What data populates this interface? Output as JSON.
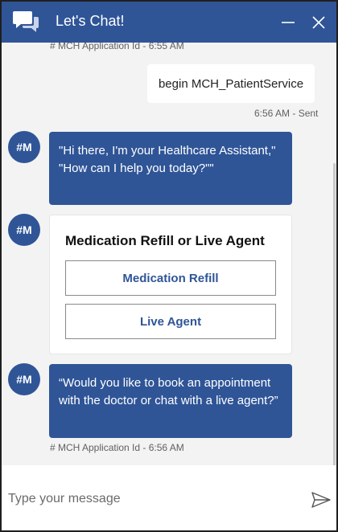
{
  "header": {
    "title": "Let's Chat!",
    "colors": {
      "primary": "#2f5597",
      "background": "#f3f3f3"
    },
    "icons": {
      "chat": "chat-bubbles-icon",
      "minimize": "minimize-icon",
      "close": "close-icon"
    }
  },
  "messages": {
    "top_meta": "# MCH Application Id - 6:55 AM",
    "user_message": {
      "text": "begin MCH_PatientService",
      "meta": "6:56 AM - Sent"
    },
    "bot_avatar_initials": "#M",
    "bot_greeting": "\"Hi there, I'm your Healthcare Assistant,\" \"How can I help you today?\"\"",
    "card": {
      "title": "Medication Refill or Live Agent",
      "buttons": [
        "Medication Refill",
        "Live Agent"
      ]
    },
    "bot_question": "“Would you like to book an appointment with the doctor or chat with a live agent?”",
    "bottom_meta": "# MCH Application Id - 6:56 AM"
  },
  "input": {
    "placeholder": "Type your message",
    "send_icon": "send-icon"
  }
}
